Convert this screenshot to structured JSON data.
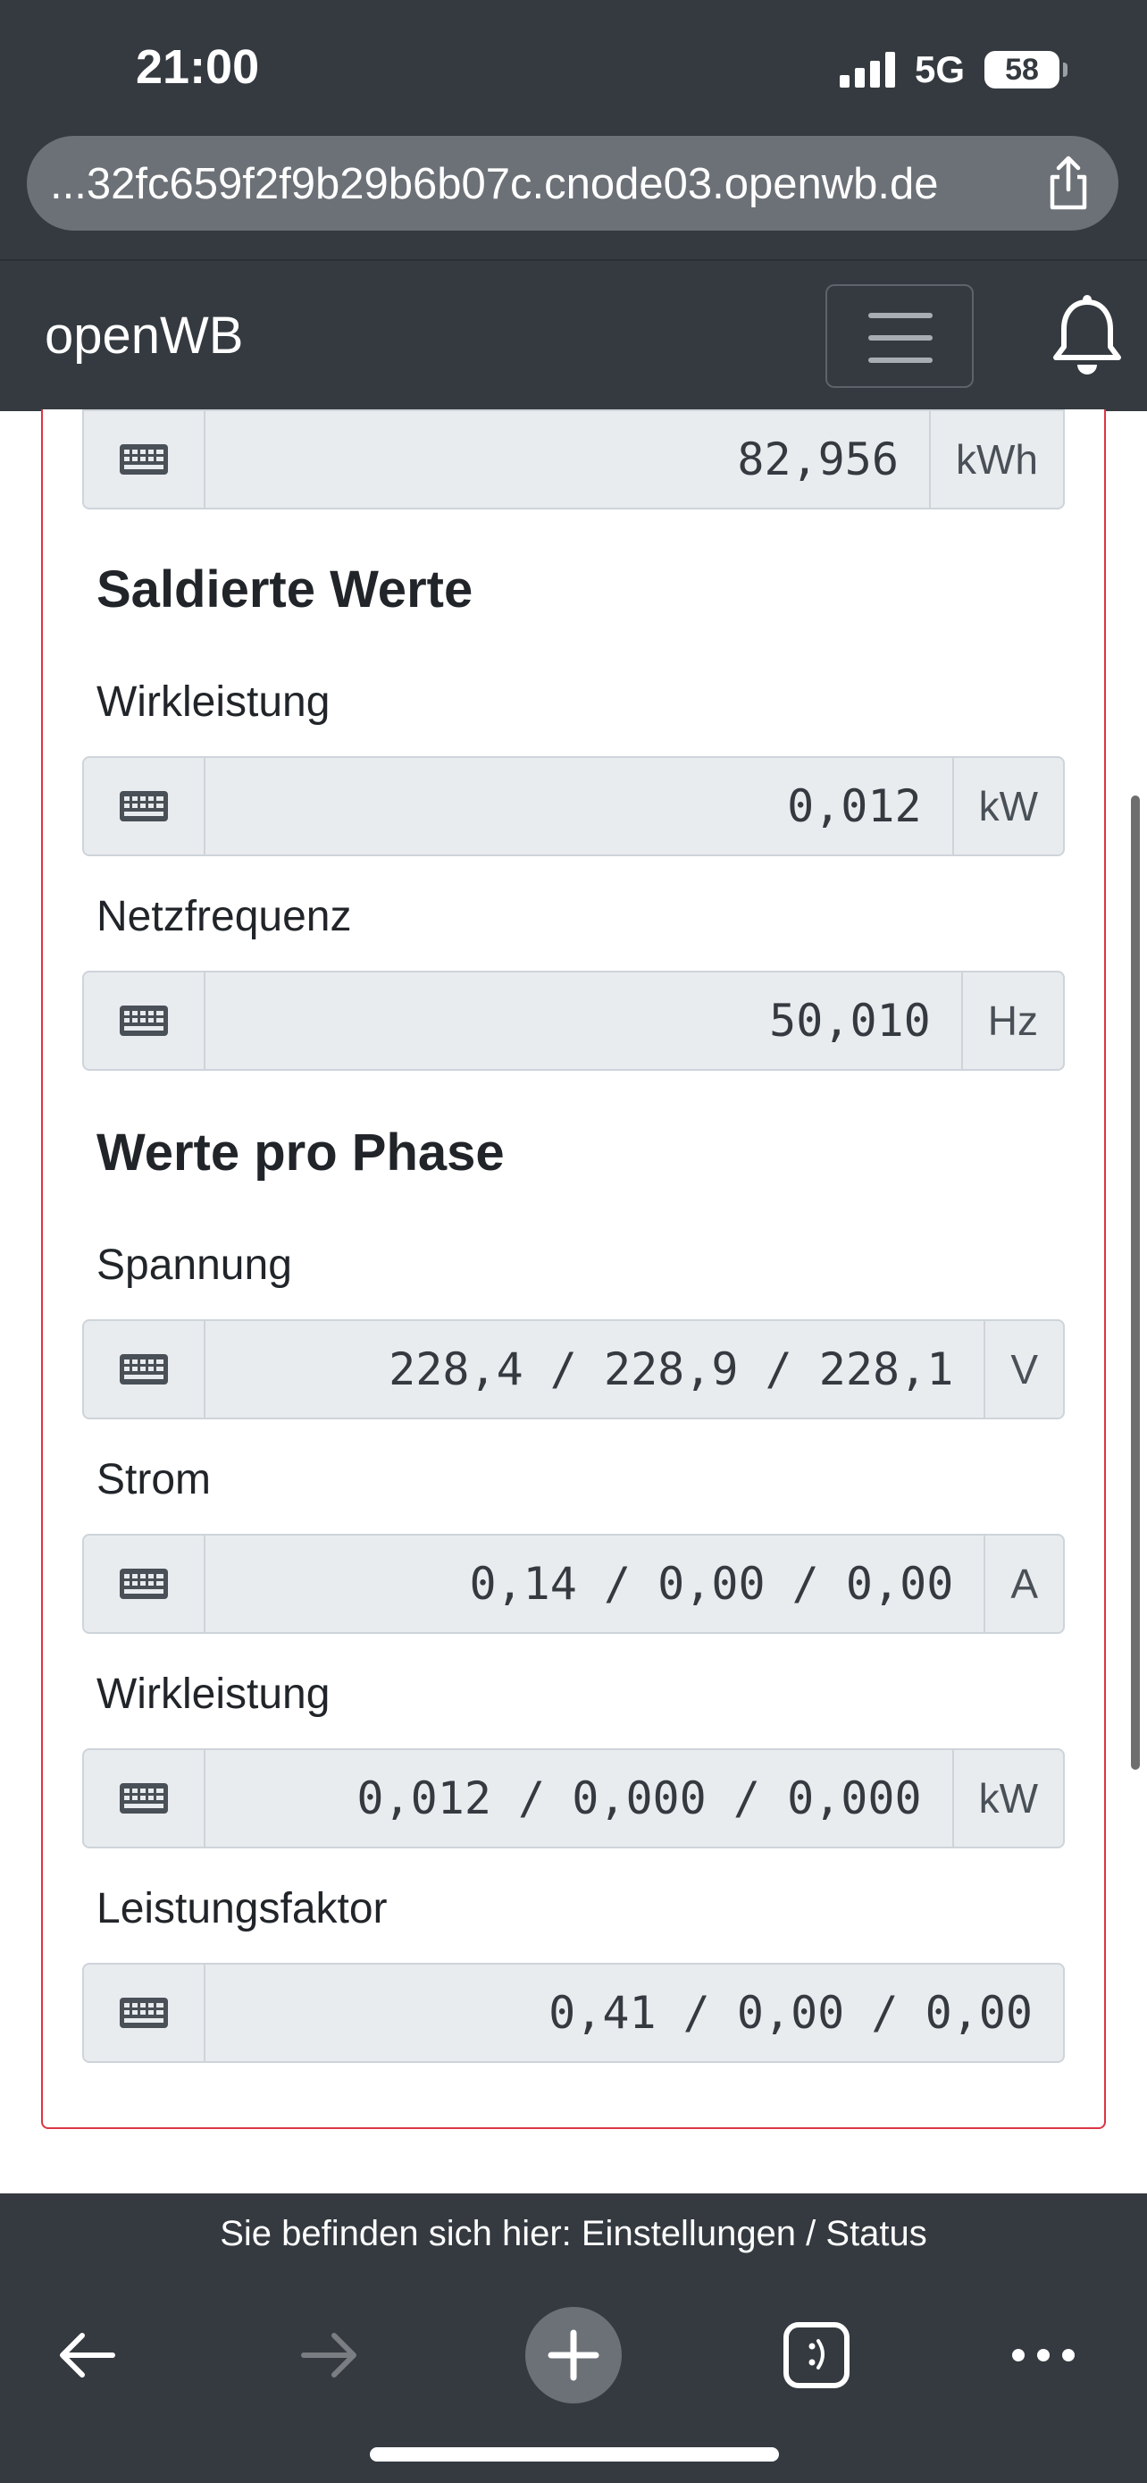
{
  "status_bar": {
    "time": "21:00",
    "network": "5G",
    "battery": "58"
  },
  "browser": {
    "url": "...32fc659f2f9b29b6b07c.cnode03.openwb.de"
  },
  "navbar": {
    "brand": "openWB"
  },
  "content": {
    "top_field": {
      "value": "82,956",
      "unit": "kWh"
    },
    "saldierte": {
      "title": "Saldierte Werte",
      "wirkleistung": {
        "label": "Wirkleistung",
        "value": "0,012",
        "unit": "kW"
      },
      "netzfrequenz": {
        "label": "Netzfrequenz",
        "value": "50,010",
        "unit": "Hz"
      }
    },
    "phase": {
      "title": "Werte pro Phase",
      "spannung": {
        "label": "Spannung",
        "value": "228,4 / 228,9 / 228,1",
        "unit": "V"
      },
      "strom": {
        "label": "Strom",
        "value": "0,14 / 0,00 / 0,00",
        "unit": "A"
      },
      "wirkleistung": {
        "label": "Wirkleistung",
        "value": "0,012 / 0,000 / 0,000",
        "unit": "kW"
      },
      "leistungsfaktor": {
        "label": "Leistungsfaktor",
        "value": "0,41 / 0,00 / 0,00"
      }
    }
  },
  "footer": {
    "breadcrumb": "Sie befinden sich hier: Einstellungen / Status"
  },
  "icons": {
    "keyboard": "keyboard-icon",
    "share": "share-icon",
    "bell": "bell-icon",
    "menu": "hamburger-icon",
    "back": "back-arrow-icon",
    "forward": "forward-arrow-icon",
    "new_tab": "plus-icon",
    "tabs": "tabs-icon",
    "more": "more-icon"
  }
}
